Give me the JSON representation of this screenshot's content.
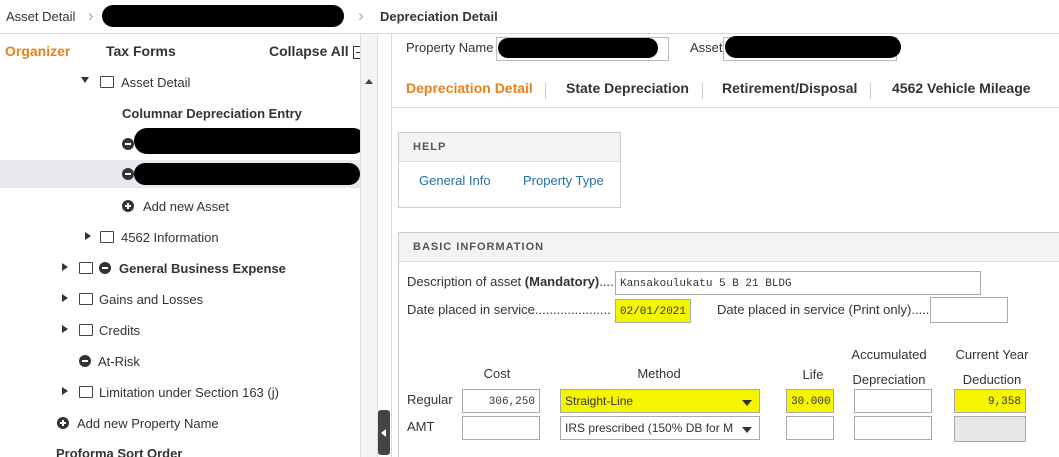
{
  "breadcrumb": {
    "item1": "Asset Detail",
    "item3": "Depreciation Detail"
  },
  "left": {
    "tabs": {
      "organizer": "Organizer",
      "tax_forms": "Tax Forms",
      "collapse_all": "Collapse All"
    },
    "tree": {
      "asset_detail": "Asset Detail",
      "columnar": "Columnar Depreciation Entry",
      "add_new_asset": "Add new Asset",
      "info_4562": "4562 Information",
      "general_business_expense": "General Business Expense",
      "gains_losses": "Gains and Losses",
      "credits": "Credits",
      "at_risk": "At-Risk",
      "limitation": "Limitation under Section 163 (j)",
      "add_property": "Add new Property Name",
      "proforma": "Proforma Sort Order"
    }
  },
  "right": {
    "property_name_label": "Property Name",
    "asset_label": "Asset",
    "tabs": [
      "Depreciation Detail",
      "State Depreciation",
      "Retirement/Disposal",
      "4562 Vehicle Mileage"
    ],
    "help": {
      "title": "HELP",
      "general_info": "General Info",
      "property_type": "Property Type"
    },
    "basic": {
      "title": "BASIC INFORMATION",
      "desc_label": "Description of asset",
      "desc_mandatory": "(Mandatory)",
      "desc_dots": "....",
      "desc_value": "Kansakoulukatu 5 B 21 BLDG",
      "date_label": "Date placed in service",
      "date_dots": ".....................",
      "date_value": "02/01/2021",
      "date_print_label": "Date placed in service (Print only)",
      "date_print_dots": "......",
      "col_cost": "Cost",
      "col_method": "Method",
      "col_life": "Life",
      "col_accum_1": "Accumulated",
      "col_accum_2": "Depreciation",
      "col_cy_1": "Current Year",
      "col_cy_2": "Deduction",
      "regular_label": "Regular",
      "amt_label": "AMT",
      "regular_cost": "306,250",
      "regular_method": "Straight-Line",
      "regular_life": "30.000",
      "regular_deduction": "9,358",
      "amt_method": "IRS prescribed (150% DB for M"
    }
  },
  "colors": {
    "accent": "#e8801d",
    "link": "#2670a8",
    "highlight": "#f5f500"
  }
}
